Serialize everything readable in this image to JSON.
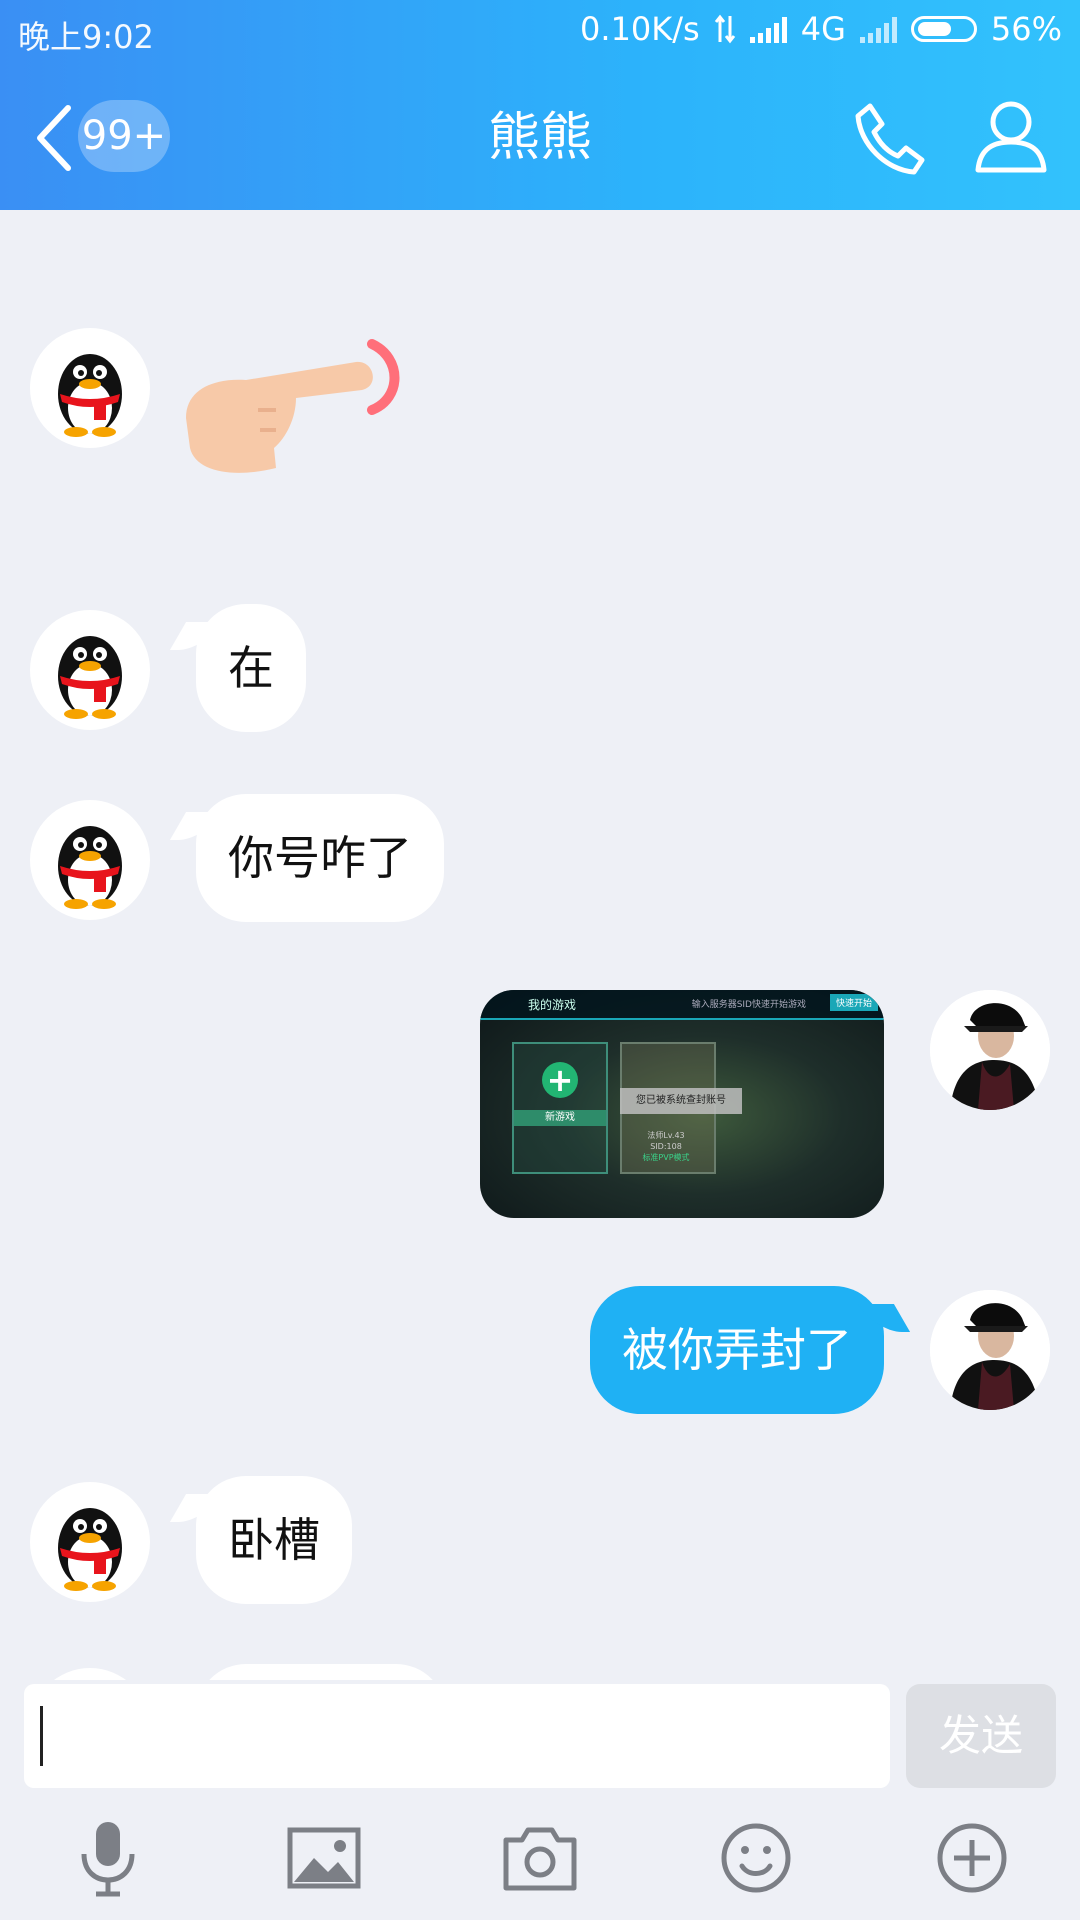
{
  "status_bar": {
    "time": "晚上9:02",
    "net_speed": "0.10K/s",
    "network": "4G",
    "battery": "56%"
  },
  "header": {
    "unread_badge": "99+",
    "title": "熊熊"
  },
  "messages": [
    {
      "side": "left",
      "type": "emoji",
      "emoji": "pointing-hand"
    },
    {
      "side": "left",
      "type": "text",
      "text": "在"
    },
    {
      "side": "left",
      "type": "text",
      "text": "你号咋了"
    },
    {
      "side": "right",
      "type": "image",
      "image": {
        "header_title": "我的游戏",
        "header_hint": "输入服务器SID快速开始游戏",
        "header_button": "快速开始",
        "new_game_label": "新游戏",
        "banned_notice": "您已被系统查封账号",
        "account_level": "法师Lv.43",
        "server_id": "SID:108",
        "mode": "标准PVP模式"
      }
    },
    {
      "side": "right",
      "type": "text",
      "text": "被你弄封了"
    },
    {
      "side": "left",
      "type": "text",
      "text": "卧槽"
    }
  ],
  "composer": {
    "input_value": "",
    "send_label": "发送"
  },
  "toolbar": {
    "icons": [
      "microphone-icon",
      "image-icon",
      "camera-icon",
      "emoji-icon",
      "plus-icon"
    ]
  },
  "colors": {
    "header_start": "#3a8ff4",
    "header_end": "#32c2fc",
    "outgoing_bubble": "#1fb1f4",
    "incoming_bubble": "#ffffff",
    "background": "#eef0f6"
  }
}
